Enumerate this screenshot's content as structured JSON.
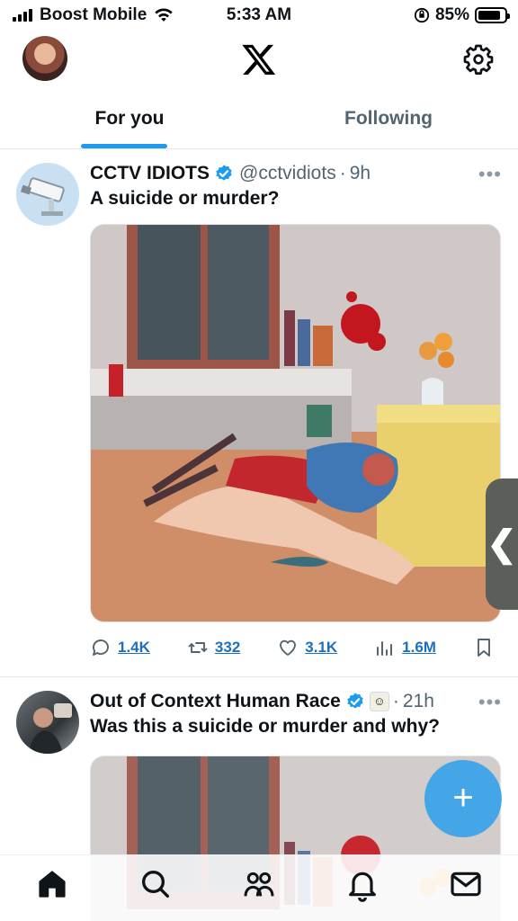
{
  "status_bar": {
    "carrier": "Boost Mobile",
    "time": "5:33 AM",
    "battery": "85%",
    "battery_level": 0.85
  },
  "header": {
    "logo_icon": "x-logo-icon",
    "settings_icon": "gear-icon"
  },
  "tabs": [
    {
      "label": "For you",
      "active": true
    },
    {
      "label": "Following",
      "active": false
    }
  ],
  "tweets": [
    {
      "name": "CCTV IDIOTS",
      "handle": "@cctvidiots",
      "dot": "·",
      "time": "9h",
      "text": "A suicide or murder?",
      "replies": "1.4K",
      "reposts": "332",
      "likes": "3.1K",
      "views": "1.6M"
    },
    {
      "name": "Out of Context Human Race",
      "dot": "·",
      "time": "21h",
      "text": "Was this a suicide or murder and why?"
    }
  ],
  "side_handle": "❮",
  "fab_label": "+",
  "colors": {
    "accent": "#1d9bf0",
    "text": "#0f1419",
    "muted": "#536471"
  }
}
